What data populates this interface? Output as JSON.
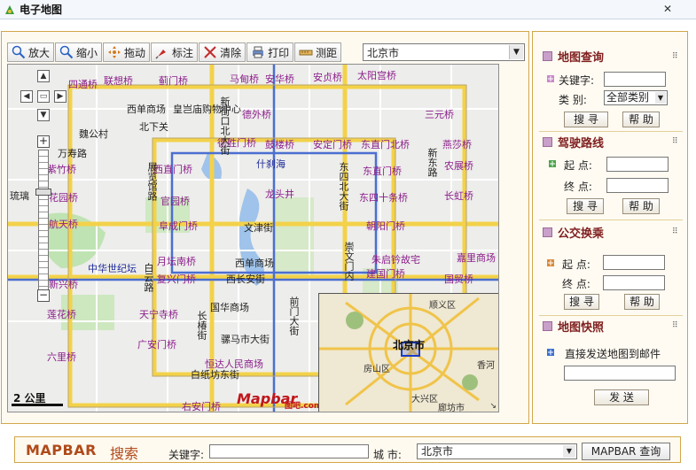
{
  "window": {
    "title": "电子地图",
    "close_glyph": "✕"
  },
  "toolbar": {
    "tools": [
      {
        "label": "放大",
        "icon": "zoom-in-icon"
      },
      {
        "label": "缩小",
        "icon": "zoom-out-icon"
      },
      {
        "label": "拖动",
        "icon": "pan-icon"
      },
      {
        "label": "标注",
        "icon": "pin-icon"
      },
      {
        "label": "清除",
        "icon": "clear-icon"
      },
      {
        "label": "打印",
        "icon": "print-icon"
      },
      {
        "label": "测距",
        "icon": "measure-icon"
      }
    ],
    "city_value": "北京市"
  },
  "map": {
    "labels": [
      "四通桥",
      "联想桥",
      "蓟门桥",
      "马甸桥",
      "安华桥",
      "安贞桥",
      "太阳宫桥",
      "三元桥",
      "西单商场",
      "皇岂庙购物中心",
      "德胜门桥",
      "鼓楼桥",
      "安定门桥",
      "东直门北桥",
      "燕莎桥",
      "紫竹桥",
      "西直门桥",
      "什刹海",
      "东直门桥",
      "农展桥",
      "花园桥",
      "官园桥",
      "龙头井",
      "东四十条桥",
      "长虹桥",
      "航天桥",
      "阜成门桥",
      "文津街",
      "朝阳门桥",
      "中华世纪坛",
      "月坛南桥",
      "西单商场",
      "朱启钤故宅",
      "嘉里商场",
      "新兴桥",
      "复兴门桥",
      "西长安街",
      "建国门桥",
      "国贸桥",
      "莲花桥",
      "天宁寺桥",
      "国华商场",
      "广安门桥",
      "骡马市大街",
      "六里桥",
      "白纸坊东街",
      "恒达人民商场",
      "右安门桥",
      "万寿路",
      "魏公村",
      "北下关",
      "新街口北大街",
      "德外桥",
      "展览馆路",
      "东四北大街",
      "新东路",
      "长椿街",
      "崇文门内",
      "前门大街",
      "白云路",
      "琉璃"
    ],
    "scale": "2 公里",
    "logo": "Mapbar",
    "logo_suffix": "图吧.com",
    "overview": {
      "center": "北京市",
      "labels": [
        "顺义区",
        "房山区",
        "大兴区",
        "廊坊市",
        "香河"
      ]
    },
    "corner_glyph": "↘"
  },
  "sidebar": {
    "map_query": {
      "title": "地图查询",
      "keyword_label": "关键字:",
      "category_label": "类  别:",
      "category_value": "全部类别",
      "search_label": "搜 寻",
      "help_label": "帮 助"
    },
    "driving": {
      "title": "驾驶路线",
      "start_label": "起 点:",
      "end_label": "终 点:",
      "search_label": "搜 寻",
      "help_label": "帮 助"
    },
    "transit": {
      "title": "公交换乘",
      "start_label": "起 点:",
      "end_label": "终 点:",
      "search_label": "搜 寻",
      "help_label": "帮 助"
    },
    "snapshot": {
      "title": "地图快照",
      "send_label": "直接发送地图到邮件",
      "send_button": "发 送"
    }
  },
  "bottom": {
    "brand": "MAPBAR",
    "brand_cn": "搜索",
    "keyword_label": "关键字:",
    "city_label": "城    市:",
    "city_value": "北京市",
    "query_button": "MAPBAR 查询"
  },
  "colors": {
    "frame": "#d2a64a",
    "heading": "#7f1f1f",
    "pink_label": "#8b1e8b",
    "blue_label": "#1d2a9a",
    "road_yellow": "#f3d24a",
    "road_blue": "#4b6fd0"
  }
}
